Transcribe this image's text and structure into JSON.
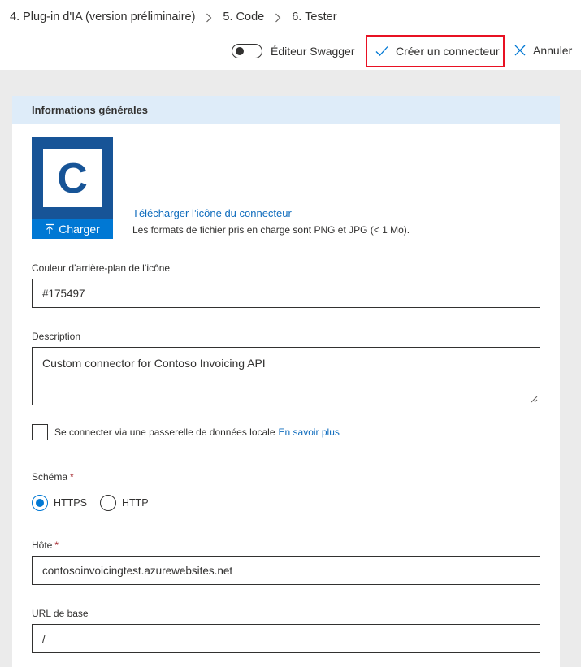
{
  "wizard": {
    "steps": [
      {
        "label": "4. Plug-in d'IA (version préliminaire)"
      },
      {
        "label": "5. Code"
      },
      {
        "label": "6. Tester"
      }
    ]
  },
  "toolbar": {
    "swagger_label": "Éditeur Swagger",
    "swagger_on": false,
    "create_label": "Créer un connecteur",
    "cancel_label": "Annuler"
  },
  "general": {
    "section_title": "Informations générales",
    "icon_letter": "C",
    "upload_button": "Charger",
    "upload_link": "Télécharger l’icône du connecteur",
    "upload_hint": "Les formats de fichier pris en charge sont PNG et JPG (< 1 Mo).",
    "bg_color_label": "Couleur d’arrière-plan de l’icône",
    "bg_color_value": "#175497",
    "description_label": "Description",
    "description_value": "Custom connector for Contoso Invoicing API",
    "gateway_label": "Se connecter via une passerelle de données locale",
    "gateway_link": "En savoir plus",
    "gateway_checked": false,
    "scheme_label": "Schéma",
    "required_mark": "*",
    "scheme_options": [
      "HTTPS",
      "HTTP"
    ],
    "scheme_selected": "HTTPS",
    "host_label": "Hôte",
    "host_value": "contosoinvoicingtest.azurewebsites.net",
    "base_url_label": "URL de base",
    "base_url_value": "/"
  },
  "colors": {
    "accent": "#0078d4",
    "icon_background": "#175497",
    "header_band": "#deecf9",
    "highlight_border": "#e81123",
    "link": "#0f6cbd"
  },
  "icons": {
    "chevron": "chevron-right-icon",
    "create": "checkmark-icon",
    "cancel": "close-icon",
    "upload": "upload-arrow-icon"
  }
}
